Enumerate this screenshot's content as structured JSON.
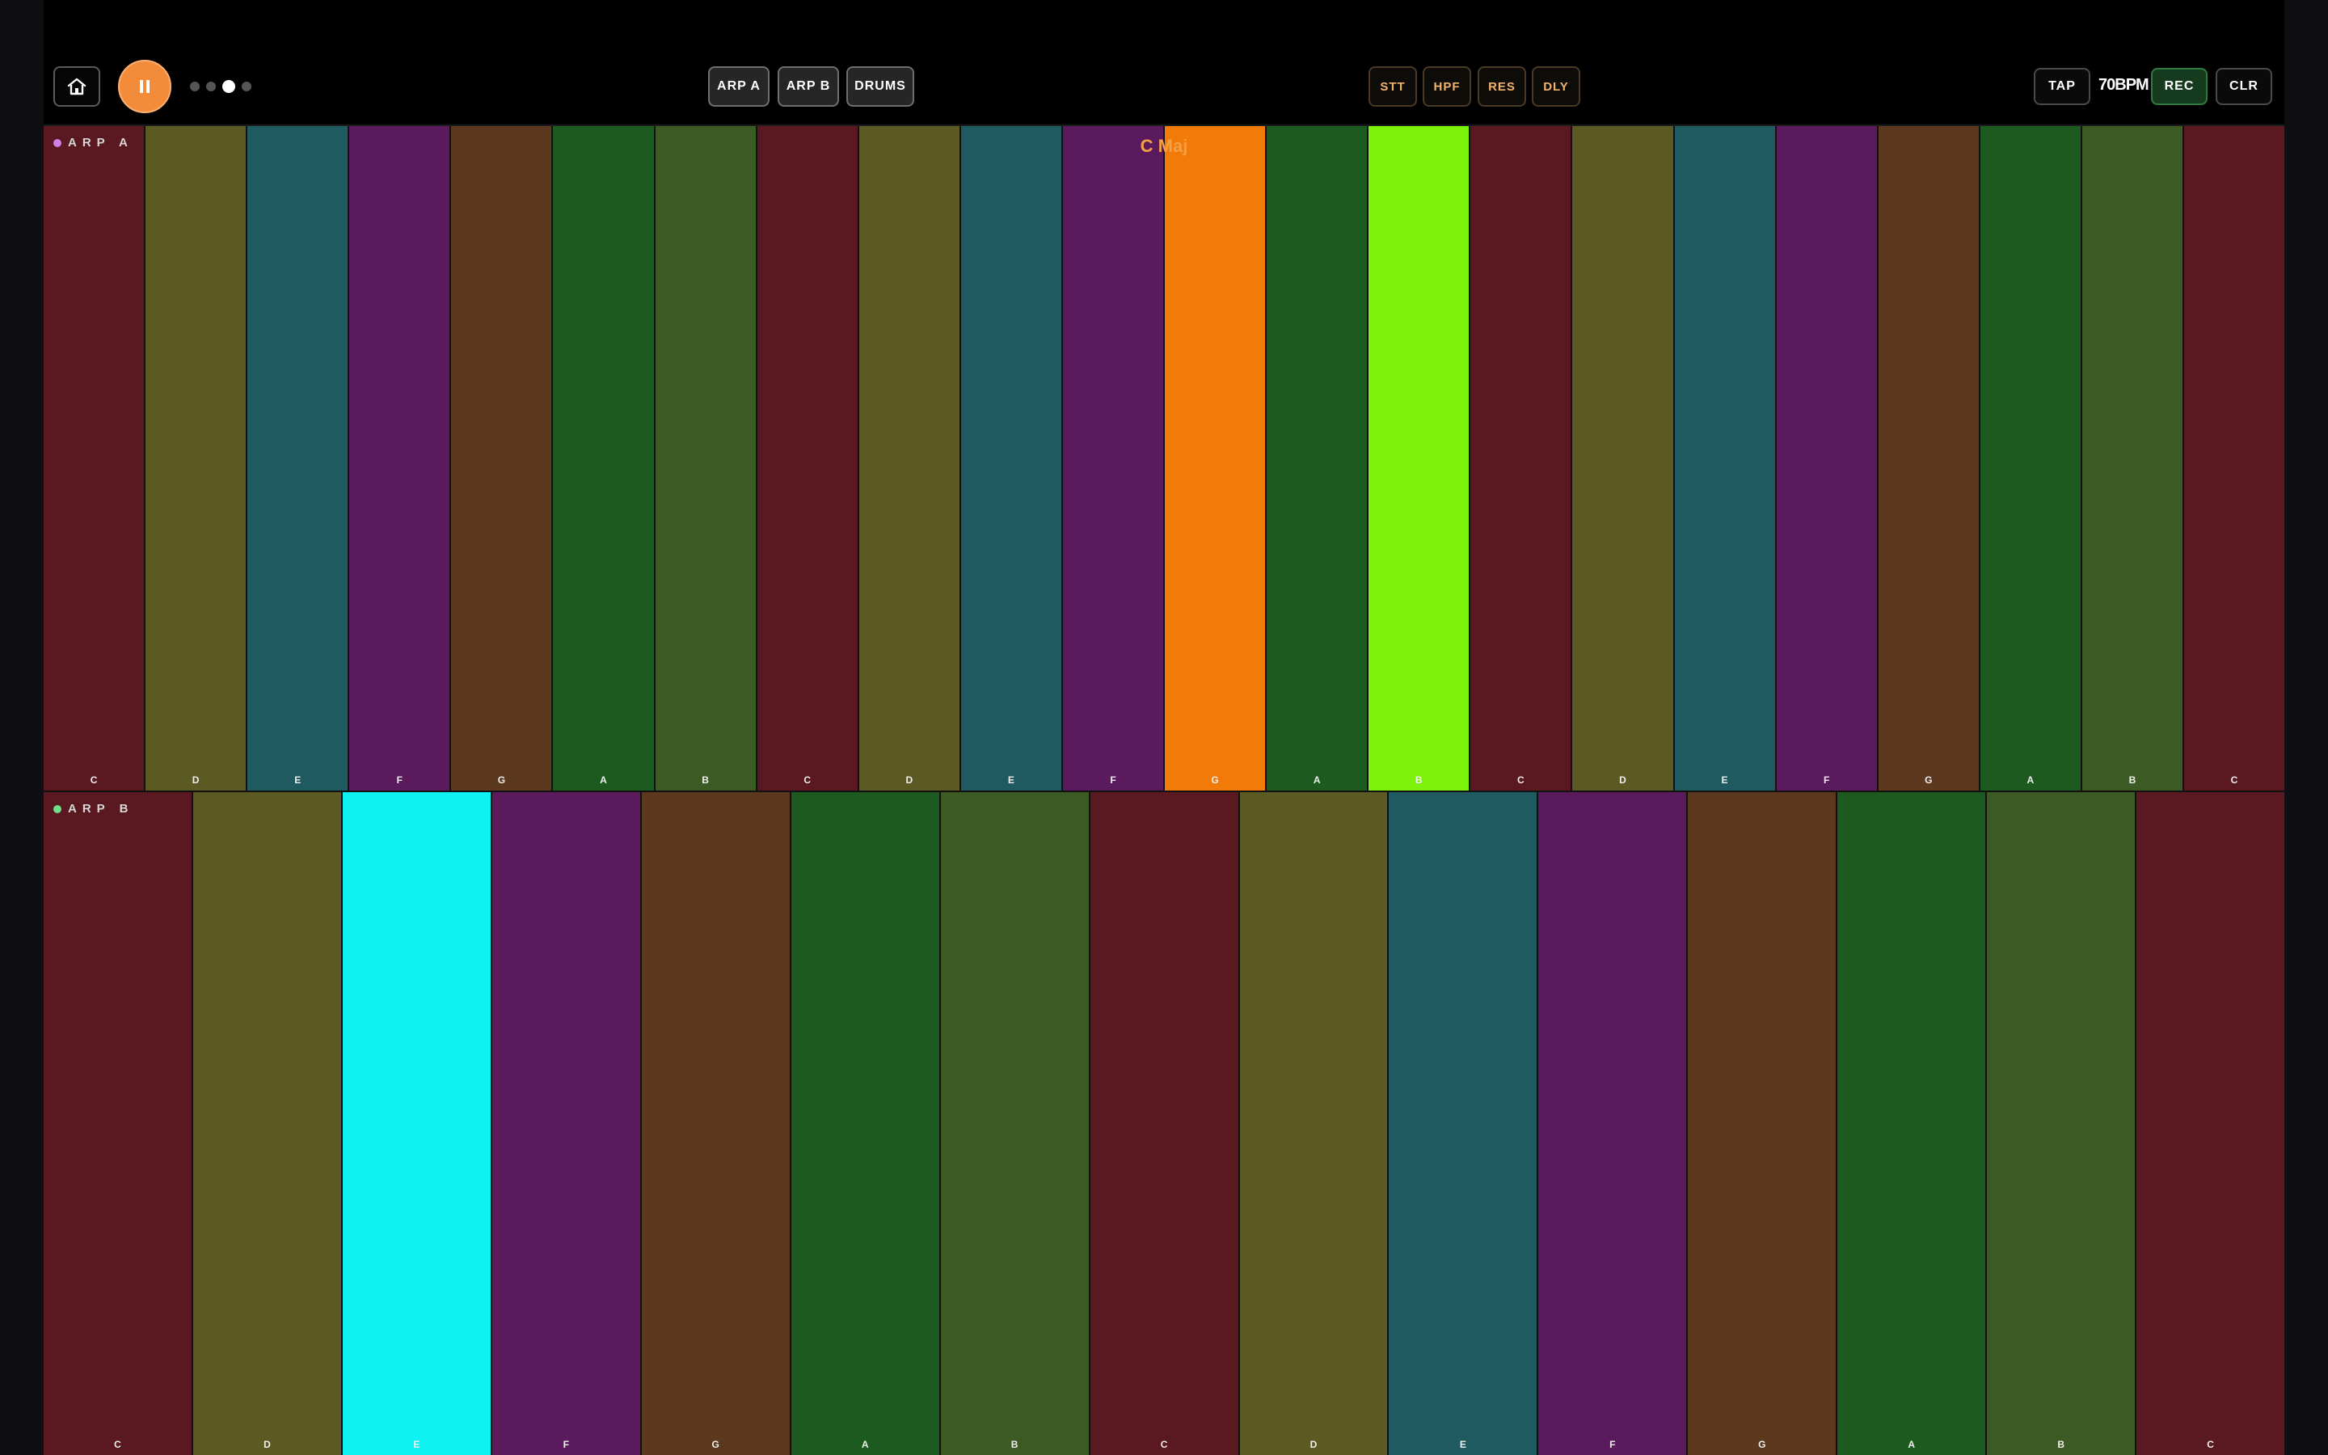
{
  "topbar": {
    "home_icon": "home-icon",
    "play_state_icon": "pause-icon",
    "page_dots": 4,
    "active_page": 2,
    "tracks": [
      {
        "label": "ARP A"
      },
      {
        "label": "ARP B"
      },
      {
        "label": "DRUMS"
      }
    ],
    "fx": [
      {
        "label": "STT"
      },
      {
        "label": "HPF"
      },
      {
        "label": "RES"
      },
      {
        "label": "DLY"
      }
    ],
    "tap_label": "TAP",
    "bpm_label": "70BPM",
    "rec_label": "REC",
    "clr_label": "CLR"
  },
  "scale_label": "C Maj",
  "colors": {
    "C": "#5a1820",
    "D": "#5b5a22",
    "E": "#1f5a60",
    "F": "#5a1a5c",
    "G": "#5c381e",
    "A": "#1d5a20",
    "B": "#3c5a24",
    "accent_orange": "#f28b3a",
    "highlight_g": "#f27a08",
    "highlight_b": "#7cf20a",
    "highlight_e": "#0ef2f2"
  },
  "arp_a": {
    "label": "ARP A",
    "dot_color": "#d080e8",
    "keys": [
      {
        "note": "C"
      },
      {
        "note": "D"
      },
      {
        "note": "E"
      },
      {
        "note": "F"
      },
      {
        "note": "G"
      },
      {
        "note": "A"
      },
      {
        "note": "B"
      },
      {
        "note": "C"
      },
      {
        "note": "D"
      },
      {
        "note": "E"
      },
      {
        "note": "F"
      },
      {
        "note": "G",
        "active": "#f27a08"
      },
      {
        "note": "A"
      },
      {
        "note": "B",
        "active": "#7cf20a"
      },
      {
        "note": "C"
      },
      {
        "note": "D"
      },
      {
        "note": "E"
      },
      {
        "note": "F"
      },
      {
        "note": "G"
      },
      {
        "note": "A"
      },
      {
        "note": "B"
      },
      {
        "note": "C"
      }
    ]
  },
  "arp_b": {
    "label": "ARP B",
    "dot_color": "#6ee08a",
    "keys": [
      {
        "note": "C"
      },
      {
        "note": "D"
      },
      {
        "note": "E",
        "active": "#0ef2f2"
      },
      {
        "note": "F"
      },
      {
        "note": "G"
      },
      {
        "note": "A"
      },
      {
        "note": "B"
      },
      {
        "note": "C"
      },
      {
        "note": "D"
      },
      {
        "note": "E"
      },
      {
        "note": "F"
      },
      {
        "note": "G"
      },
      {
        "note": "A"
      },
      {
        "note": "B"
      },
      {
        "note": "C"
      }
    ]
  }
}
